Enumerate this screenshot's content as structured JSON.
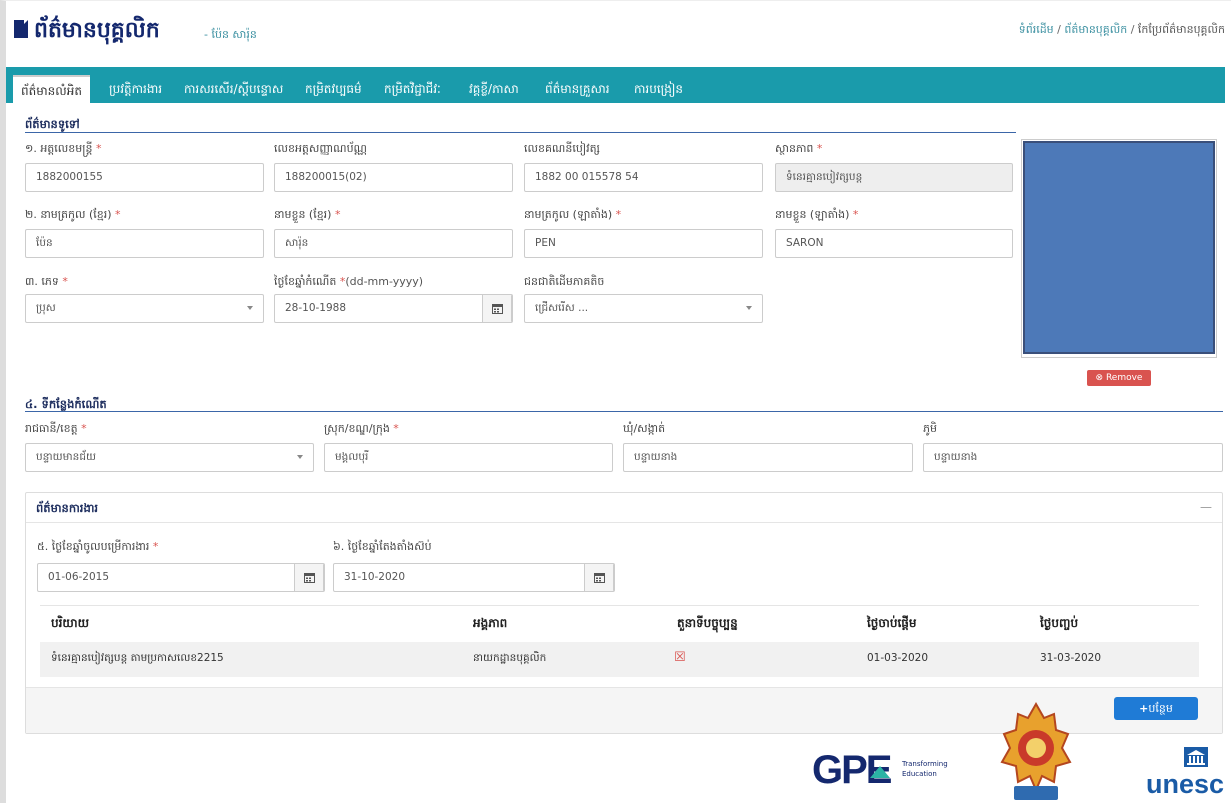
{
  "header": {
    "title": "ព័ត៌មានបុគ្គលិក",
    "subtitle": "- ប៉ែន សារ៉ុន",
    "breadcrumb": [
      "ទំព័រដើម",
      "ព័ត៌មានបុគ្គលិក",
      "កែប្រែព័ត៌មានបុគ្គលិក"
    ]
  },
  "tabs": [
    "ព័ត៌មានលំអិត",
    "ប្រវត្តិការងារ",
    "ការសរសើរ/ស្តីបន្ទោស",
    "កម្រិតវប្បធម៌",
    "កម្រិតវិជ្ជាជីវៈ",
    "វគ្គខ្លី/ភាសា",
    "ព័ត៌មានគ្រួសារ",
    "ការបង្រៀន"
  ],
  "general": {
    "section_title": "ព័ត៌មានទូទៅ",
    "officer_no_label": "១. អត្តលេខមន្ត្រី",
    "officer_no": "1882000155",
    "id_card_label": "លេខអត្តសញ្ញាណប័ណ្ណ",
    "id_card": "188200015(02)",
    "bank_label": "លេខគណនីបៀវត្ស",
    "bank": "1882 00 015578 54",
    "status_label": "ស្ថានភាព",
    "status": "ទំនេរគ្មានបៀវត្សបន្ត",
    "surname_kh_label": "២. នាមត្រកូល (ខ្មែរ)",
    "surname_kh": "ប៉ែន",
    "name_kh_label": "នាមខ្លួន (ខ្មែរ)",
    "name_kh": "សារ៉ុន",
    "surname_en_label": "នាមត្រកូល (ឡាតាំង)",
    "surname_en": "PEN",
    "name_en_label": "នាមខ្លួន (ឡាតាំង)",
    "name_en": "SARON",
    "gender_label": "៣. ភេទ",
    "gender": "ប្រុស",
    "dob_label": "ថ្ងៃខែឆ្នាំកំណើត",
    "dob_format": "(dd-mm-yyyy)",
    "dob": "28-10-1988",
    "ethnic_label": "ជនជាតិដើមភាគតិច",
    "ethnic": "ជ្រើសរើស ...",
    "remove_label": "Remove"
  },
  "birthplace": {
    "section_title": "៤. ទីកន្លែងកំណើត",
    "province_label": "រាជធានី/ខេត្ត",
    "province": "បន្ទាយមានជ័យ",
    "district_label": "ស្រុក/ខណ្ឌ/ក្រុង",
    "district": "មង្គលបុរី",
    "commune_label": "ឃុំ/សង្កាត់",
    "commune": "បន្ទាយនាង",
    "village_label": "ភូមិ",
    "village": "បន្ទាយនាង"
  },
  "work": {
    "panel_title": "ព័ត៌មានការងារ",
    "collapse_symbol": "—",
    "start_label": "៥. ថ្ងៃខែឆ្នាំចូលបម្រើការងារ",
    "start": "01-06-2015",
    "appoint_label": "៦. ថ្ងៃខែឆ្នាំតែងតាំងស៊ប់",
    "appoint": "31-10-2020",
    "table_headers": [
      "បរិយាយ",
      "អង្គភាព",
      "តួនាទីបច្ចុប្បន្ន",
      "ថ្ងៃចាប់ផ្ដើម",
      "ថ្ងៃបញ្ចប់"
    ],
    "rows": [
      {
        "desc": "ទំនេរគ្មានបៀវត្សបន្ត តាមប្រកាសលេខ2215",
        "unit": "នាយកដ្ឋានបុគ្គលិក",
        "current": "☒",
        "start": "01-03-2020",
        "end": "31-03-2020"
      }
    ],
    "add_label": "បន្ថែម"
  },
  "footer": {
    "gpe_logo": "GPE",
    "gpe_tagline_1": "Transforming",
    "gpe_tagline_2": "Education",
    "unesco_text": "unesc"
  },
  "colors": {
    "accent": "#1a9bab",
    "title_navy": "#14286e",
    "link_teal": "#3a8fa0",
    "remove_red": "#d9534f",
    "add_blue": "#1f7bd6",
    "photo_blue": "#4d79b8",
    "unesco_blue": "#1a5ba6"
  }
}
